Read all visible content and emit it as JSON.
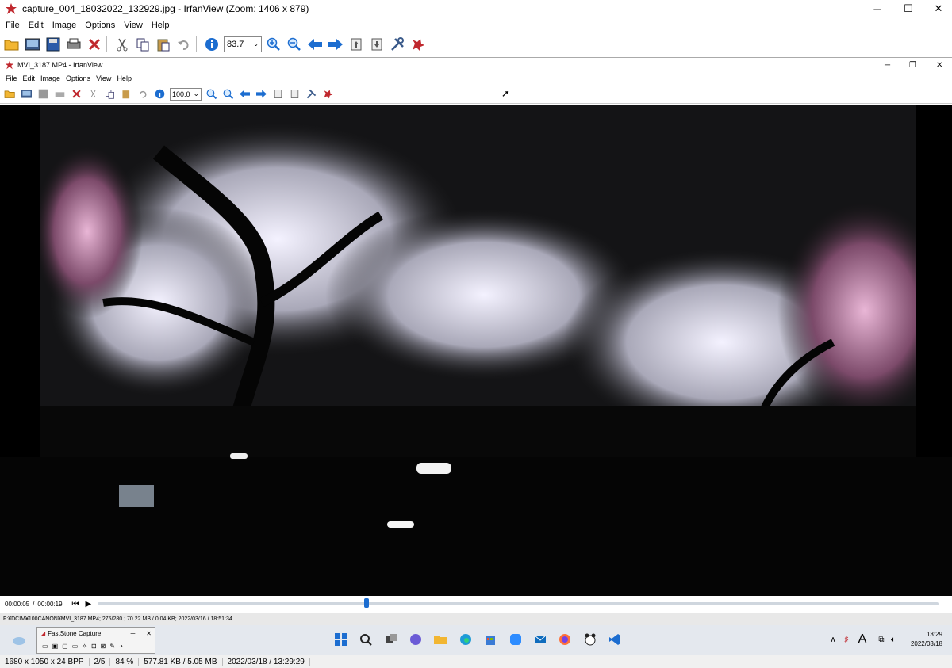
{
  "outer": {
    "title": "capture_004_18032022_132929.jpg - IrfanView (Zoom: 1406 x 879)",
    "menu": [
      "File",
      "Edit",
      "Image",
      "Options",
      "View",
      "Help"
    ],
    "zoom_value": "83.7",
    "status": {
      "dimensions": "1680 x 1050 x 24 BPP",
      "index": "2/5",
      "zoom": "84 %",
      "size": "577.81 KB / 5.05 MB",
      "datetime": "2022/03/18 / 13:29:29"
    }
  },
  "inner": {
    "title": "MVI_3187.MP4 - IrfanView",
    "menu": [
      "File",
      "Edit",
      "Image",
      "Options",
      "View",
      "Help"
    ],
    "zoom_value": "100.0",
    "time_current": "00:00:05",
    "time_total": "00:00:19",
    "time_sep": "/",
    "video_progress": 0.32,
    "status_line": "F:¥DCIM¥100CANON¥MVI_3187.MP4; 275/280 ; 70.22 MB / 0.04 KB; 2022/03/16 / 18:51:34"
  },
  "taskbar": {
    "faststone_title": "FastStone Capture",
    "clock_time": "13:29",
    "clock_date": "2022/03/18",
    "ime": "A"
  },
  "colors": {
    "accent_blue": "#1c6dd0",
    "irfan_red": "#c0282e",
    "folder_yellow": "#f2b632"
  }
}
